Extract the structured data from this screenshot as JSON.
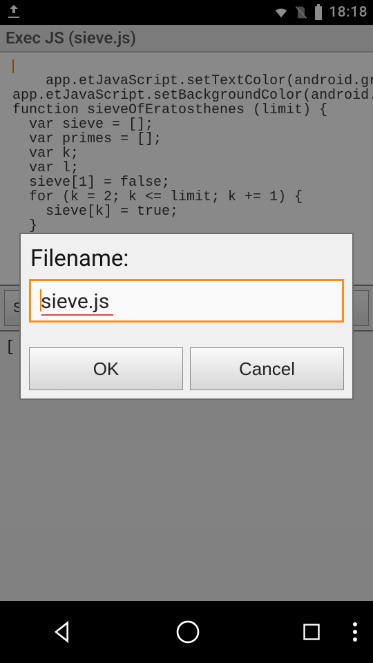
{
  "status": {
    "clock": "18:18"
  },
  "appbar": {
    "title": "Exec JS (sieve.js)"
  },
  "code": {
    "text": "app.etJavaScript.setTextColor(android.graphics\napp.etJavaScript.setBackgroundColor(android.gra\nfunction sieveOfEratosthenes (limit) {\n  var sieve = [];\n  var primes = [];\n  var k;\n  var l;\n  sieve[1] = false;\n  for (k = 2; k <= limit; k += 1) {\n    sieve[k] = true;\n  }\n  for (k = 2; k * k <= limit; k += 1) {\n    if (sieve[k] !== true) {\n      continue;"
  },
  "toolbar": {
    "save_label": "Save"
  },
  "output": {
    "text": "["
  },
  "dialog": {
    "title": "Filename:",
    "input_value": "sieve.js",
    "ok_label": "OK",
    "cancel_label": "Cancel"
  },
  "colors": {
    "accent": "#ff8c1a"
  }
}
